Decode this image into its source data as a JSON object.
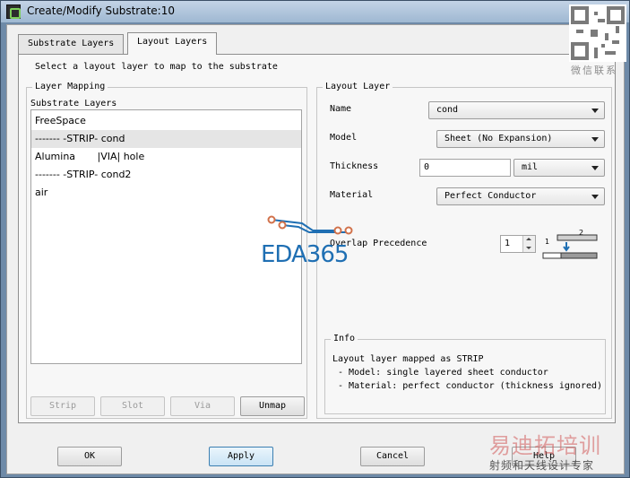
{
  "window": {
    "title": "Create/Modify Substrate:10"
  },
  "tabs": [
    {
      "label": "Substrate Layers",
      "active": false
    },
    {
      "label": "Layout Layers",
      "active": true
    }
  ],
  "instruction": "Select a layout layer to map to the substrate",
  "layer_mapping": {
    "group_label": "Layer Mapping",
    "list_label": "Substrate Layers",
    "items": [
      "FreeSpace",
      "------- -STRIP- cond",
      "Alumina       |VIA| hole",
      "------- -STRIP- cond2",
      "air"
    ],
    "selected_index": 1,
    "buttons": {
      "strip": "Strip",
      "slot": "Slot",
      "via": "Via",
      "unmap": "Unmap"
    }
  },
  "layout_layer": {
    "group_label": "Layout Layer",
    "name_label": "Name",
    "name_value": "cond",
    "model_label": "Model",
    "model_value": "Sheet (No Expansion)",
    "thickness_label": "Thickness",
    "thickness_value": "0",
    "thickness_unit": "mil",
    "material_label": "Material",
    "material_value": "Perfect Conductor",
    "overlap_label": "Overlap Precedence",
    "overlap_value": "1"
  },
  "info": {
    "group_label": "Info",
    "lines": [
      "Layout layer mapped as STRIP",
      " - Model: single layered sheet conductor",
      " - Material: perfect conductor (thickness ignored)"
    ]
  },
  "footer": {
    "ok": "OK",
    "apply": "Apply",
    "cancel": "Cancel",
    "help": "Help"
  },
  "watermark": {
    "brand": "EDA365",
    "qr_caption": "微信联系",
    "cn_title": "易迪拓培训",
    "cn_subtitle": "射频和天线设计专家"
  },
  "colors": {
    "accent_blue": "#1f6fb3",
    "selection": "#e5e5e5"
  }
}
